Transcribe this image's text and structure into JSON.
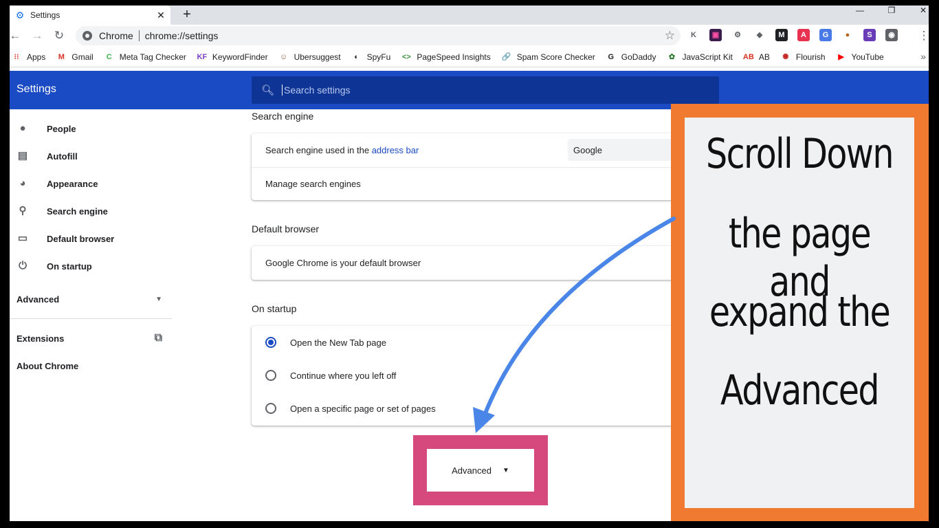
{
  "tab": {
    "title": "Settings",
    "icon": "gear-icon"
  },
  "window": {
    "minimize": "—",
    "maximize": "❐",
    "close": "✕"
  },
  "toolbar": {
    "omnibox_label": "Chrome",
    "url": "chrome://settings"
  },
  "extensions": [
    {
      "name": "ext-k-icon",
      "glyph": "K",
      "bg": "#ffffff",
      "fg": "#5f6368"
    },
    {
      "name": "ext-frame-icon",
      "glyph": "▣",
      "bg": "#3c1c4f",
      "fg": "#ff4ea3"
    },
    {
      "name": "ext-cog-icon",
      "glyph": "⚙",
      "bg": "#ffffff",
      "fg": "#5f6368"
    },
    {
      "name": "ext-puzzle-icon",
      "glyph": "◆",
      "bg": "#ffffff",
      "fg": "#5f6368"
    },
    {
      "name": "ext-m-icon",
      "glyph": "M",
      "bg": "#202124",
      "fg": "#ffffff"
    },
    {
      "name": "ext-a-icon",
      "glyph": "A",
      "bg": "#e8324f",
      "fg": "#ffffff"
    },
    {
      "name": "ext-translate-icon",
      "glyph": "G",
      "bg": "#4a7ae8",
      "fg": "#ffffff"
    },
    {
      "name": "ext-cookie-icon",
      "glyph": "●",
      "bg": "#ffffff",
      "fg": "#b5651d"
    },
    {
      "name": "ext-s-icon",
      "glyph": "S",
      "bg": "#6a3db8",
      "fg": "#ffffff"
    },
    {
      "name": "profile-avatar-icon",
      "glyph": "◉",
      "bg": "#5f6368",
      "fg": "#ffffff"
    }
  ],
  "bookmarks": [
    {
      "label": "Apps",
      "icon": "apps-grid-icon",
      "glyph": "⁝⁝",
      "color": "#e8453c"
    },
    {
      "label": "Gmail",
      "icon": "gmail-icon",
      "glyph": "M",
      "color": "#d93025"
    },
    {
      "label": "Meta Tag Checker",
      "icon": "meta-tag-icon",
      "glyph": "C",
      "color": "#3cb54a"
    },
    {
      "label": "KeywordFinder",
      "icon": "keywordfinder-icon",
      "glyph": "KF",
      "color": "#7b3fc4"
    },
    {
      "label": "Ubersuggest",
      "icon": "ubersuggest-icon",
      "glyph": "☺",
      "color": "#8b5a3c"
    },
    {
      "label": "SpyFu",
      "icon": "spyfu-icon",
      "glyph": "◐",
      "color": "#202124"
    },
    {
      "label": "PageSpeed Insights",
      "icon": "pagespeed-icon",
      "glyph": "<>",
      "color": "#3a8e3a"
    },
    {
      "label": "Spam Score Checker",
      "icon": "spam-score-icon",
      "glyph": "🔗",
      "color": "#1a73e8"
    },
    {
      "label": "GoDaddy",
      "icon": "godaddy-icon",
      "glyph": "G",
      "color": "#202124"
    },
    {
      "label": "JavaScript Kit",
      "icon": "javascript-kit-icon",
      "glyph": "✿",
      "color": "#2e7d32"
    },
    {
      "label": "AB",
      "icon": "ab-icon",
      "glyph": "AB",
      "color": "#d93025"
    },
    {
      "label": "Flourish",
      "icon": "flourish-icon",
      "glyph": "✺",
      "color": "#c62828"
    },
    {
      "label": "YouTube",
      "icon": "youtube-icon",
      "glyph": "▶",
      "color": "#ff0000"
    }
  ],
  "header": {
    "title": "Settings",
    "search_placeholder": "Search settings"
  },
  "sidebar": {
    "items": [
      {
        "label": "People",
        "icon": "person-icon",
        "glyph": "👤"
      },
      {
        "label": "Autofill",
        "icon": "clipboard-icon",
        "glyph": "📋"
      },
      {
        "label": "Appearance",
        "icon": "palette-icon",
        "glyph": "🎨"
      },
      {
        "label": "Search engine",
        "icon": "search-icon",
        "glyph": "🔍"
      },
      {
        "label": "Default browser",
        "icon": "browser-window-icon",
        "glyph": "▭"
      },
      {
        "label": "On startup",
        "icon": "power-icon",
        "glyph": "⏻"
      }
    ],
    "advanced": "Advanced",
    "extensions": "Extensions",
    "about": "About Chrome"
  },
  "main": {
    "search_engine": {
      "title": "Search engine",
      "used_prefix": "Search engine used in the",
      "used_link": "address bar",
      "selected": "Google",
      "manage": "Manage search engines"
    },
    "default_browser": {
      "title": "Default browser",
      "status": "Google Chrome is your default browser"
    },
    "on_startup": {
      "title": "On startup",
      "options": [
        {
          "label": "Open the New Tab page",
          "checked": true
        },
        {
          "label": "Continue where you left off",
          "checked": false
        },
        {
          "label": "Open a specific page or set of pages",
          "checked": false
        }
      ]
    },
    "advanced_button": "Advanced"
  },
  "annotation": {
    "lines": [
      "Scroll Down",
      "the page and",
      "expand the",
      "Advanced"
    ],
    "frame_color": "#ef7a30",
    "highlight_color": "#d6497c",
    "arrow_color": "#4a86e8"
  }
}
